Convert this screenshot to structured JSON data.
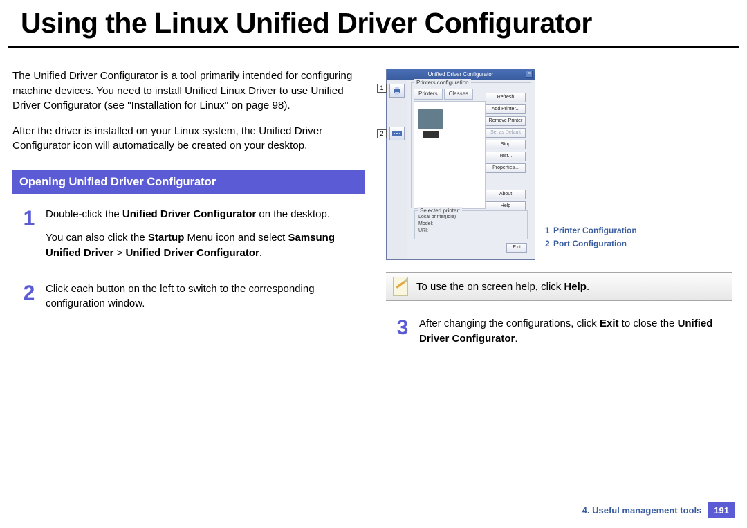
{
  "page": {
    "title": "Using the Linux Unified Driver Configurator"
  },
  "intro": {
    "p1": "The Unified Driver Configurator is a tool primarily intended for configuring machine devices. You need to install Unified Linux Driver to use Unified Driver Configurator (see \"Installation for Linux\" on page 98).",
    "p2": "After the driver is installed on your Linux system, the Unified Driver Configurator icon will automatically be created on your desktop."
  },
  "section": {
    "heading": "Opening Unified Driver Configurator"
  },
  "steps": {
    "s1": {
      "num": "1",
      "line1a": "Double-click the ",
      "line1b": "Unified Driver Configurator",
      "line1c": " on the desktop.",
      "line2a": "You can also click the ",
      "line2b": "Startup",
      "line2c": " Menu icon and select ",
      "line2d": "Samsung Unified Driver",
      "line2e": " > ",
      "line2f": "Unified Driver Configurator",
      "line2g": "."
    },
    "s2": {
      "num": "2",
      "text": "Click each button on the left to switch to the corresponding configuration window."
    },
    "s3": {
      "num": "3",
      "a": "After changing the configurations, click ",
      "b": "Exit",
      "c": " to close the ",
      "d": "Unified Driver Configurator",
      "e": "."
    }
  },
  "screenshot": {
    "title": "Unified Driver Configurator",
    "fieldset": "Printers configuration",
    "tab1": "Printers",
    "tab2": "Classes",
    "btn_refresh": "Refresh",
    "btn_add": "Add Printer...",
    "btn_remove": "Remove Printer",
    "btn_default": "Set as Default",
    "btn_stop": "Stop",
    "btn_test": "Test...",
    "btn_props": "Properties...",
    "btn_about": "About",
    "btn_help": "Help",
    "sel_label": "Selected printer:",
    "sel_l1": "Local printer(idle)",
    "sel_l2": "Model:",
    "sel_l3": "URI:",
    "exit": "Exit",
    "callout1": "1",
    "callout2": "2"
  },
  "legend": {
    "l1num": "1",
    "l1txt": "Printer Configuration",
    "l2num": "2",
    "l2txt": "Port Configuration"
  },
  "note": {
    "a": "To use the on screen help, click ",
    "b": "Help",
    "c": "."
  },
  "footer": {
    "chapter": "4.  Useful management tools",
    "page": "191"
  }
}
